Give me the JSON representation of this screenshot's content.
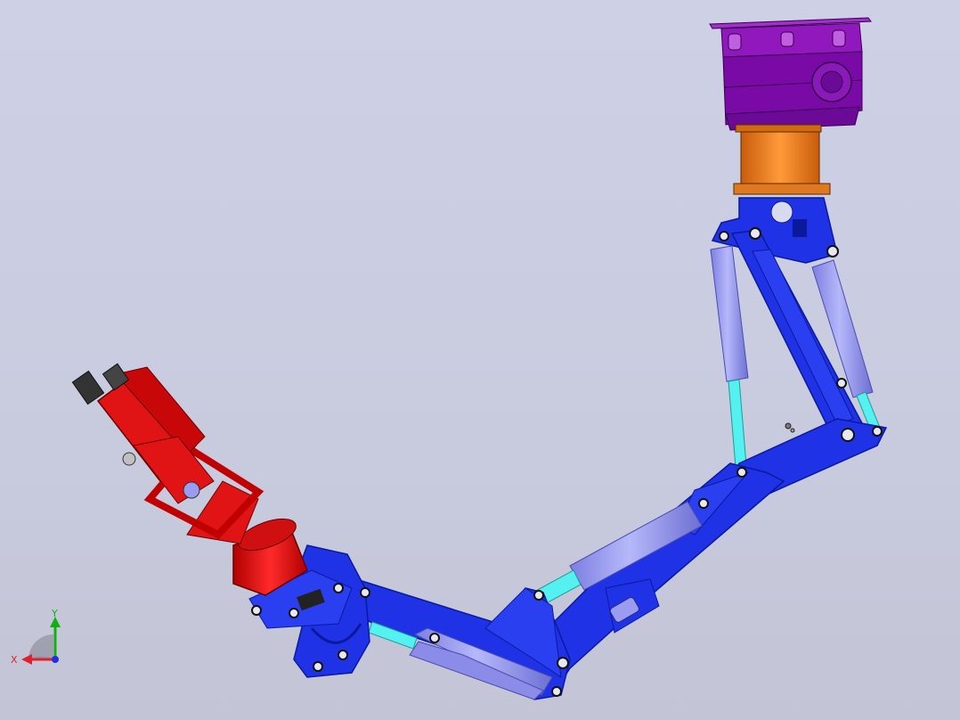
{
  "viewport": {
    "background_top": "#ced0e6",
    "background_bottom": "#c3c5d6"
  },
  "colors": {
    "link_blue": "#1f32e6",
    "link_blue_dark": "#0a1a9c",
    "cylinder": "#9a9cf0",
    "cylinder_dark": "#6f72d8",
    "rod": "#55f0f0",
    "gripper_red": "#e01414",
    "gripper_dark": "#8a0000",
    "base_purple": "#8a10b0",
    "base_purple_dark": "#5a0078",
    "bearing_orange": "#ee7a18",
    "axis_x": "#e0202a",
    "axis_y": "#10b010",
    "axis_z": "#2030e0"
  },
  "triad": {
    "x_label": "X",
    "y_label": "Y"
  },
  "parts": {
    "base": "base-mount",
    "bearing": "rotary-bearing",
    "upper_arm": "upper-arm-link",
    "forearm": "forearm-link",
    "wrist": "wrist-joint",
    "gripper": "gripper-end-effector"
  }
}
